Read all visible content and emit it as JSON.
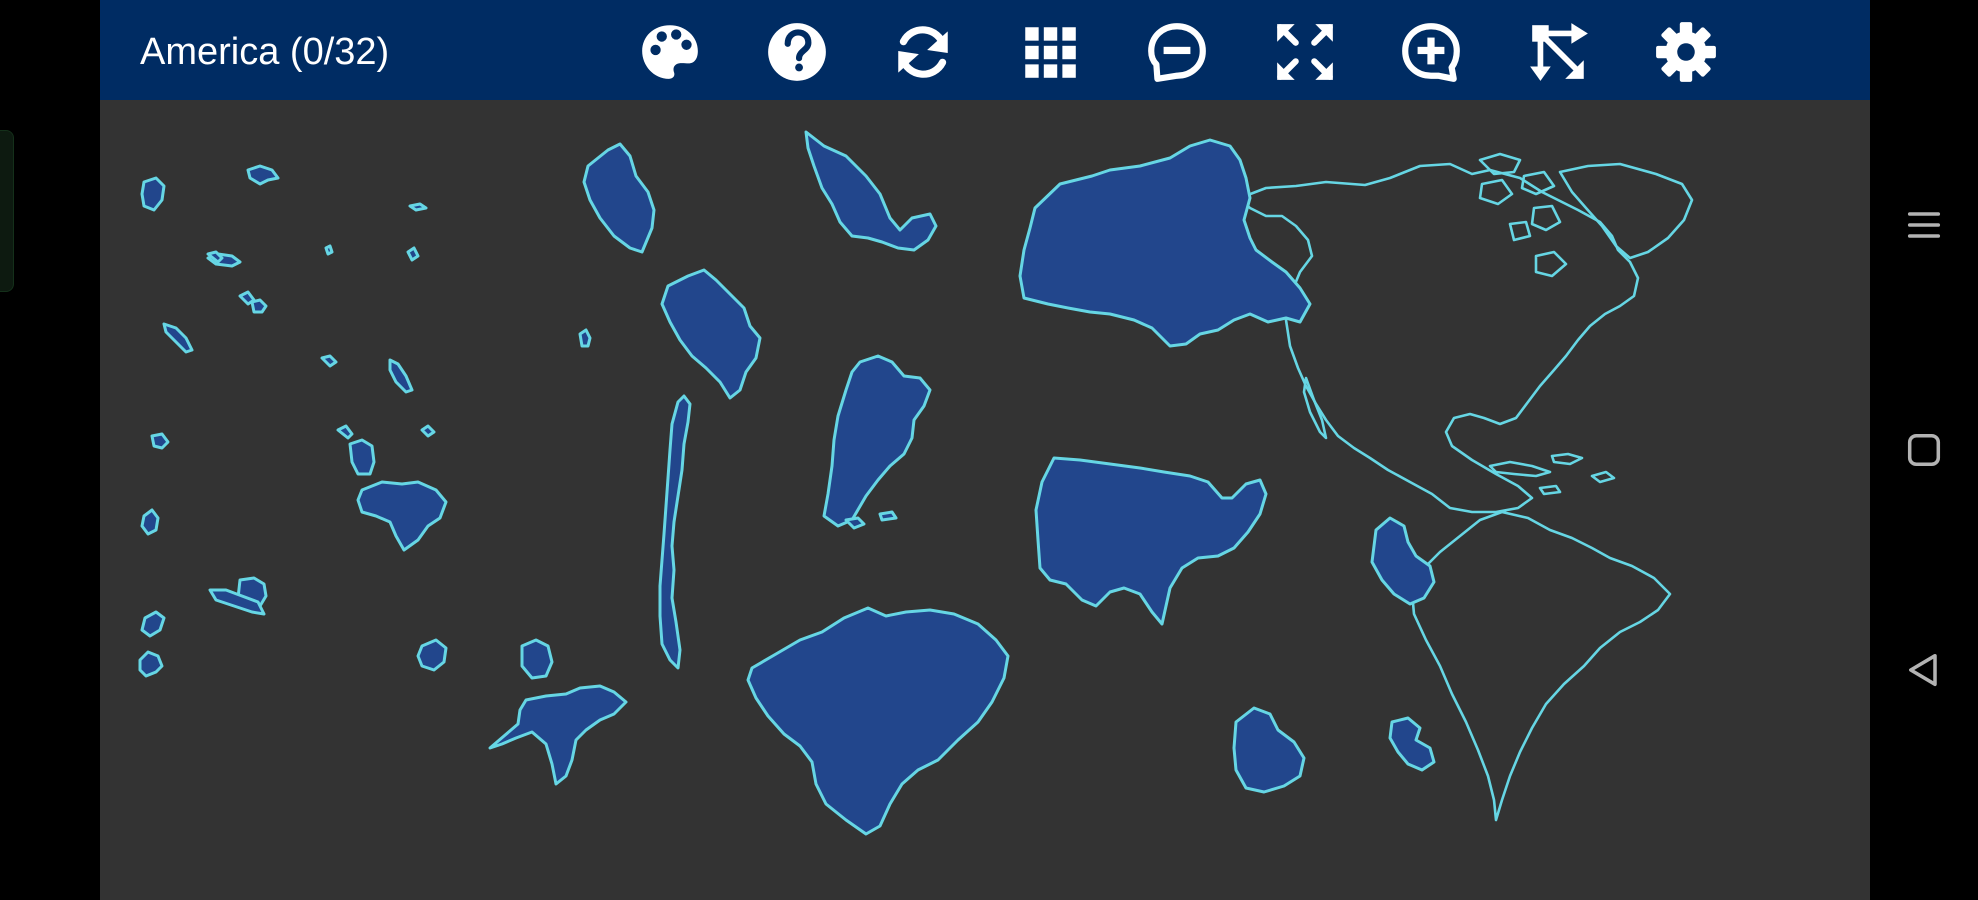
{
  "app": {
    "title": "America (0/32)",
    "colors": {
      "toolbar": "#002c63",
      "board": "#333333",
      "piece_fill": "#22468c",
      "piece_outline": "#66d6e4",
      "icon": "#ffffff"
    }
  },
  "toolbar": {
    "icons": [
      "palette-icon",
      "help-icon",
      "refresh-icon",
      "grid-icon",
      "zoom-out-icon",
      "fullscreen-icon",
      "zoom-in-icon",
      "arrange-icon",
      "gear-icon"
    ]
  },
  "game": {
    "placed": 0,
    "total": 32
  },
  "navigation_bar": {
    "icons": [
      "menu-icon",
      "home-icon",
      "back-icon"
    ]
  }
}
